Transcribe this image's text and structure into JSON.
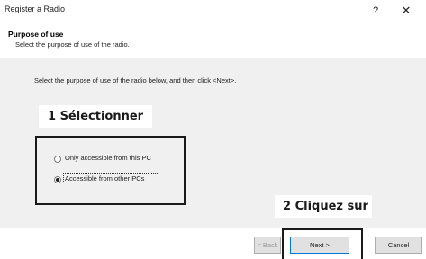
{
  "window": {
    "title": "Register a Radio",
    "help_label": "?",
    "close_label": "✕"
  },
  "header": {
    "title": "Purpose of use",
    "subtitle": "Select the purpose of use of the radio."
  },
  "body": {
    "instruction": "Select the purpose of use of the radio below, and then click <Next>.",
    "options": [
      {
        "label": "Only accessible from this PC",
        "selected": false
      },
      {
        "label": "Accessible from other PCs",
        "selected": true
      }
    ]
  },
  "callouts": {
    "step1": "1 Sélectionner",
    "step2": "2 Cliquez sur"
  },
  "buttons": {
    "back": "< Back",
    "next": "Next >",
    "cancel": "Cancel"
  }
}
